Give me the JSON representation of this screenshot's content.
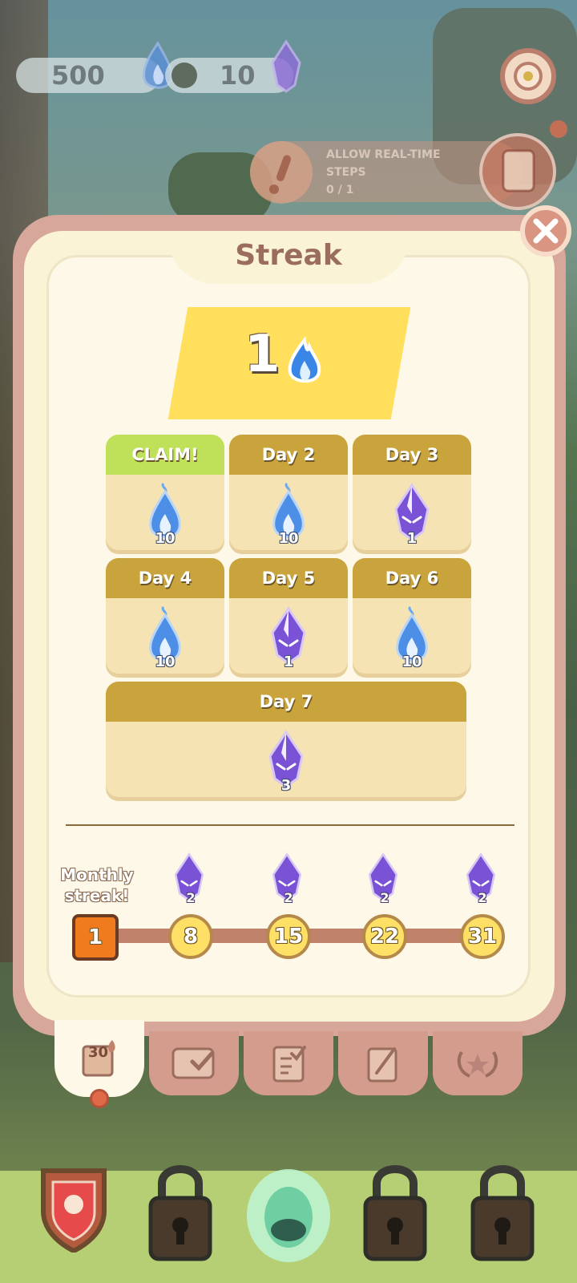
{
  "hud": {
    "flames_value": "500",
    "gems_value": "10"
  },
  "quest": {
    "line1": "ALLOW REAL-TIME",
    "line2": "STEPS",
    "progress": "0 / 1"
  },
  "panel": {
    "title": "Streak",
    "streak_count": "1"
  },
  "rewards": [
    {
      "header": "CLAIM!",
      "type": "blue-flame",
      "count": "10",
      "claimable": true
    },
    {
      "header": "Day 2",
      "type": "blue-flame",
      "count": "10"
    },
    {
      "header": "Day 3",
      "type": "purple-gem",
      "count": "1"
    },
    {
      "header": "Day 4",
      "type": "blue-flame",
      "count": "10"
    },
    {
      "header": "Day 5",
      "type": "purple-gem",
      "count": "1"
    },
    {
      "header": "Day 6",
      "type": "blue-flame",
      "count": "10"
    },
    {
      "header": "Day 7",
      "type": "purple-gem",
      "count": "3"
    }
  ],
  "monthly": {
    "label_line1": "Monthly",
    "label_line2": "streak!",
    "current_day": "1",
    "milestones": [
      {
        "day": "8",
        "reward_count": "2"
      },
      {
        "day": "15",
        "reward_count": "2"
      },
      {
        "day": "22",
        "reward_count": "2"
      },
      {
        "day": "31",
        "reward_count": "2"
      }
    ]
  },
  "tabs": {
    "calendar_label": "30"
  },
  "colors": {
    "panel_bg": "#fbf3d6",
    "card_header": "#c9a43c",
    "claim_header": "#bfe15a",
    "streak_highlight": "#ffdf5b",
    "current_marker": "#f07b1e"
  }
}
